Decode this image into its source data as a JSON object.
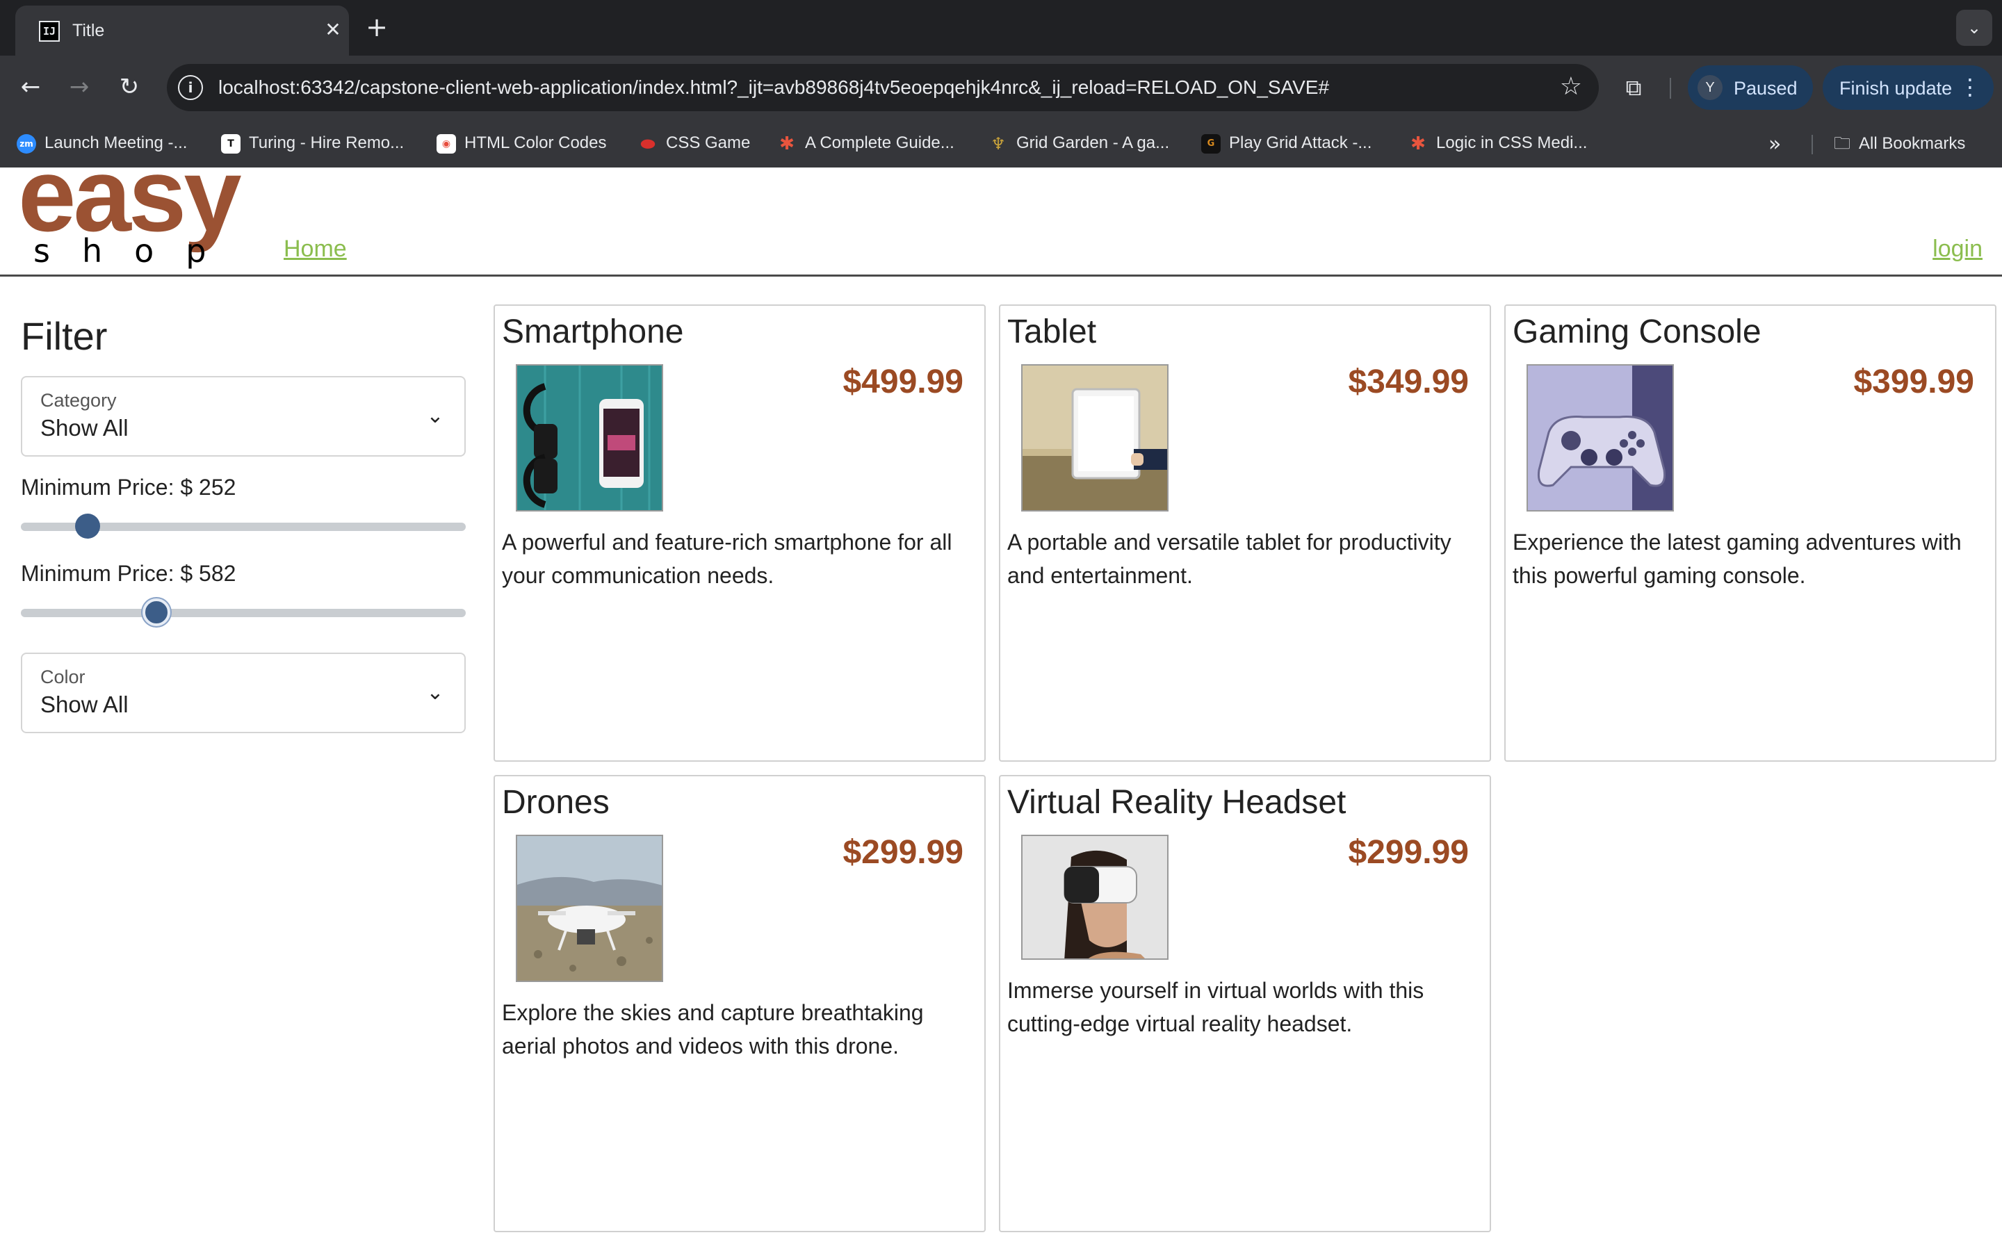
{
  "browser": {
    "tab_title": "Title",
    "tab_favicon": "IJ",
    "url": "localhost:63342/capstone-client-web-application/index.html?_ijt=avb89868j4tv5eoepqehjk4nrc&_ij_reload=RELOAD_ON_SAVE#",
    "profile_initial": "Y",
    "profile_label": "Paused",
    "update_label": "Finish update",
    "bookmarks": [
      {
        "label": "Launch Meeting -...",
        "icon": "zoom-icon",
        "color": "#2d8cff"
      },
      {
        "label": "Turing - Hire Remo...",
        "icon": "turing-icon",
        "color": "#111111"
      },
      {
        "label": "HTML Color Codes",
        "icon": "html-color-codes-icon",
        "color": "#e74c3c"
      },
      {
        "label": "CSS Game",
        "icon": "css-game-icon",
        "color": "#d9302c"
      },
      {
        "label": "A Complete Guide...",
        "icon": "asterisk-icon",
        "color": "#e8553e"
      },
      {
        "label": "Grid Garden - A ga...",
        "icon": "carrot-icon",
        "color": "#c8a23a"
      },
      {
        "label": "Play Grid Attack -...",
        "icon": "grid-attack-icon",
        "color": "#d98a1e"
      },
      {
        "label": "Logic in CSS Medi...",
        "icon": "asterisk-icon",
        "color": "#e8553e"
      }
    ],
    "all_bookmarks_label": "All Bookmarks"
  },
  "site": {
    "logo_top": "easy",
    "logo_bottom": "shop",
    "nav_home": "Home",
    "nav_login": "login",
    "brand_color": "#9b5233",
    "link_color": "#8bbd4e"
  },
  "filter": {
    "title": "Filter",
    "category_label": "Category",
    "category_value": "Show All",
    "min_price_label": "Minimum Price: $ 252",
    "min_price_value": 252,
    "max_price_label": "Minimum Price: $ 582",
    "max_price_value": 582,
    "slider_max": 2000,
    "color_label": "Color",
    "color_value": "Show All"
  },
  "products": [
    {
      "name": "Smartphone",
      "price": "$499.99",
      "description": "A powerful and feature-rich smartphone for all your communication needs.",
      "image_icon": "smartphone-photo"
    },
    {
      "name": "Tablet",
      "price": "$349.99",
      "description": "A portable and versatile tablet for productivity and entertainment.",
      "image_icon": "tablet-photo"
    },
    {
      "name": "Gaming Console",
      "price": "$399.99",
      "description": "Experience the latest gaming adventures with this powerful gaming console.",
      "image_icon": "gaming-controller-photo"
    },
    {
      "name": "Drones",
      "price": "$299.99",
      "description": "Explore the skies and capture breathtaking aerial photos and videos with this drone.",
      "image_icon": "drone-photo"
    },
    {
      "name": "Virtual Reality Headset",
      "price": "$299.99",
      "description": "Immerse yourself in virtual worlds with this cutting-edge virtual reality headset.",
      "image_icon": "vr-headset-photo"
    }
  ]
}
